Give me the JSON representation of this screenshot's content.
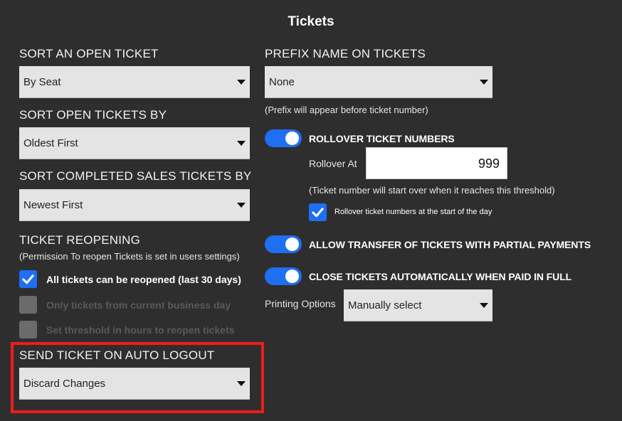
{
  "page": {
    "title": "Tickets"
  },
  "left": {
    "sort_open_ticket": {
      "label": "SORT AN OPEN TICKET",
      "value": "By Seat"
    },
    "sort_open_tickets_by": {
      "label": "SORT OPEN TICKETS BY",
      "value": "Oldest First"
    },
    "sort_completed_sales_by": {
      "label": "SORT COMPLETED SALES TICKETS BY",
      "value": "Newest First"
    },
    "reopening": {
      "label": "TICKET REOPENING",
      "note": "(Permission To reopen Tickets is set in users settings)",
      "options": [
        {
          "label": "All tickets can be reopened (last 30 days)",
          "checked": true,
          "enabled": true
        },
        {
          "label": "Only tickets from current business day",
          "checked": false,
          "enabled": false
        },
        {
          "label": "Set threshold in hours to reopen tickets",
          "checked": false,
          "enabled": false
        }
      ]
    },
    "auto_logout": {
      "label": "SEND TICKET ON AUTO LOGOUT",
      "value": "Discard Changes"
    }
  },
  "right": {
    "prefix": {
      "label": "PREFIX NAME ON TICKETS",
      "value": "None",
      "note": "(Prefix will appear before ticket number)"
    },
    "rollover": {
      "label": "ROLLOVER TICKET NUMBERS",
      "enabled": true,
      "at_label": "Rollover At",
      "at_value": "999",
      "note": "(Ticket number will start over when it reaches this threshold)",
      "daily_label": "Rollover ticket numbers at the start of the day",
      "daily_checked": true
    },
    "allow_transfer": {
      "label": "ALLOW TRANSFER OF TICKETS WITH PARTIAL PAYMENTS",
      "enabled": true
    },
    "close_auto": {
      "label": "CLOSE TICKETS AUTOMATICALLY WHEN PAID IN FULL",
      "enabled": true
    },
    "printing": {
      "label": "Printing Options",
      "value": "Manually select"
    }
  },
  "colors": {
    "accent": "#1e6ff2",
    "highlight": "#f01c1c",
    "background": "#2e2e2e"
  }
}
